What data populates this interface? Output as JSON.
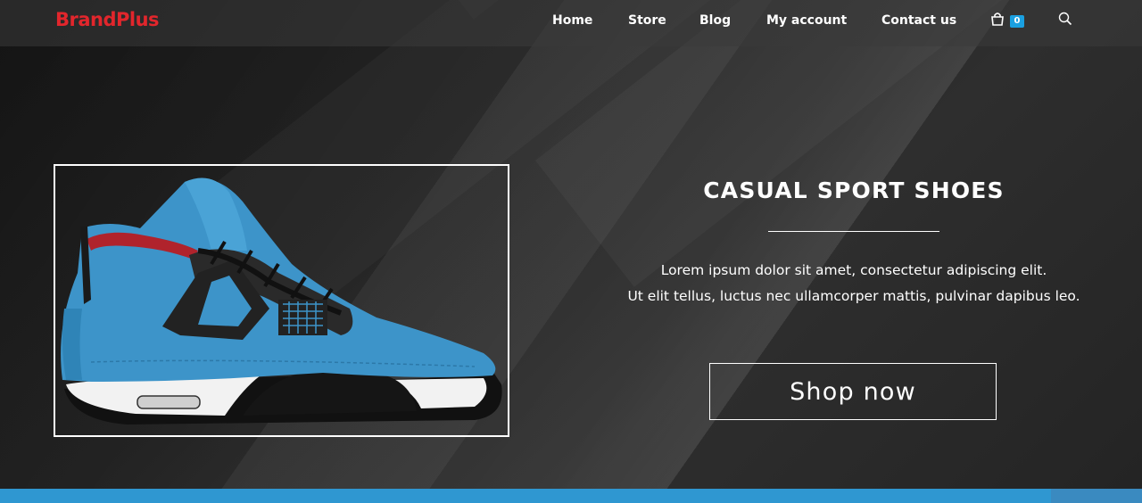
{
  "brand": {
    "name": "BrandPlus",
    "color": "#e2262c"
  },
  "nav": {
    "items": [
      {
        "label": "Home"
      },
      {
        "label": "Store"
      },
      {
        "label": "Blog"
      },
      {
        "label": "My account"
      },
      {
        "label": "Contact us"
      }
    ],
    "cart_icon": "shopping-bag-icon",
    "cart_count": "0",
    "search_icon": "search-icon"
  },
  "hero": {
    "product_image": "blue-sneaker",
    "title": "CASUAL SPORT SHOES",
    "description_line1": "Lorem ipsum dolor sit amet, consectetur adipiscing elit.",
    "description_line2": "Ut elit tellus, luctus nec ullamcorper mattis, pulvinar dapibus leo.",
    "button_label": "Shop now"
  },
  "colors": {
    "accent_blue": "#1aa0e1",
    "bottom_bar": "#2f97d1",
    "background": "#1e1e1e"
  }
}
